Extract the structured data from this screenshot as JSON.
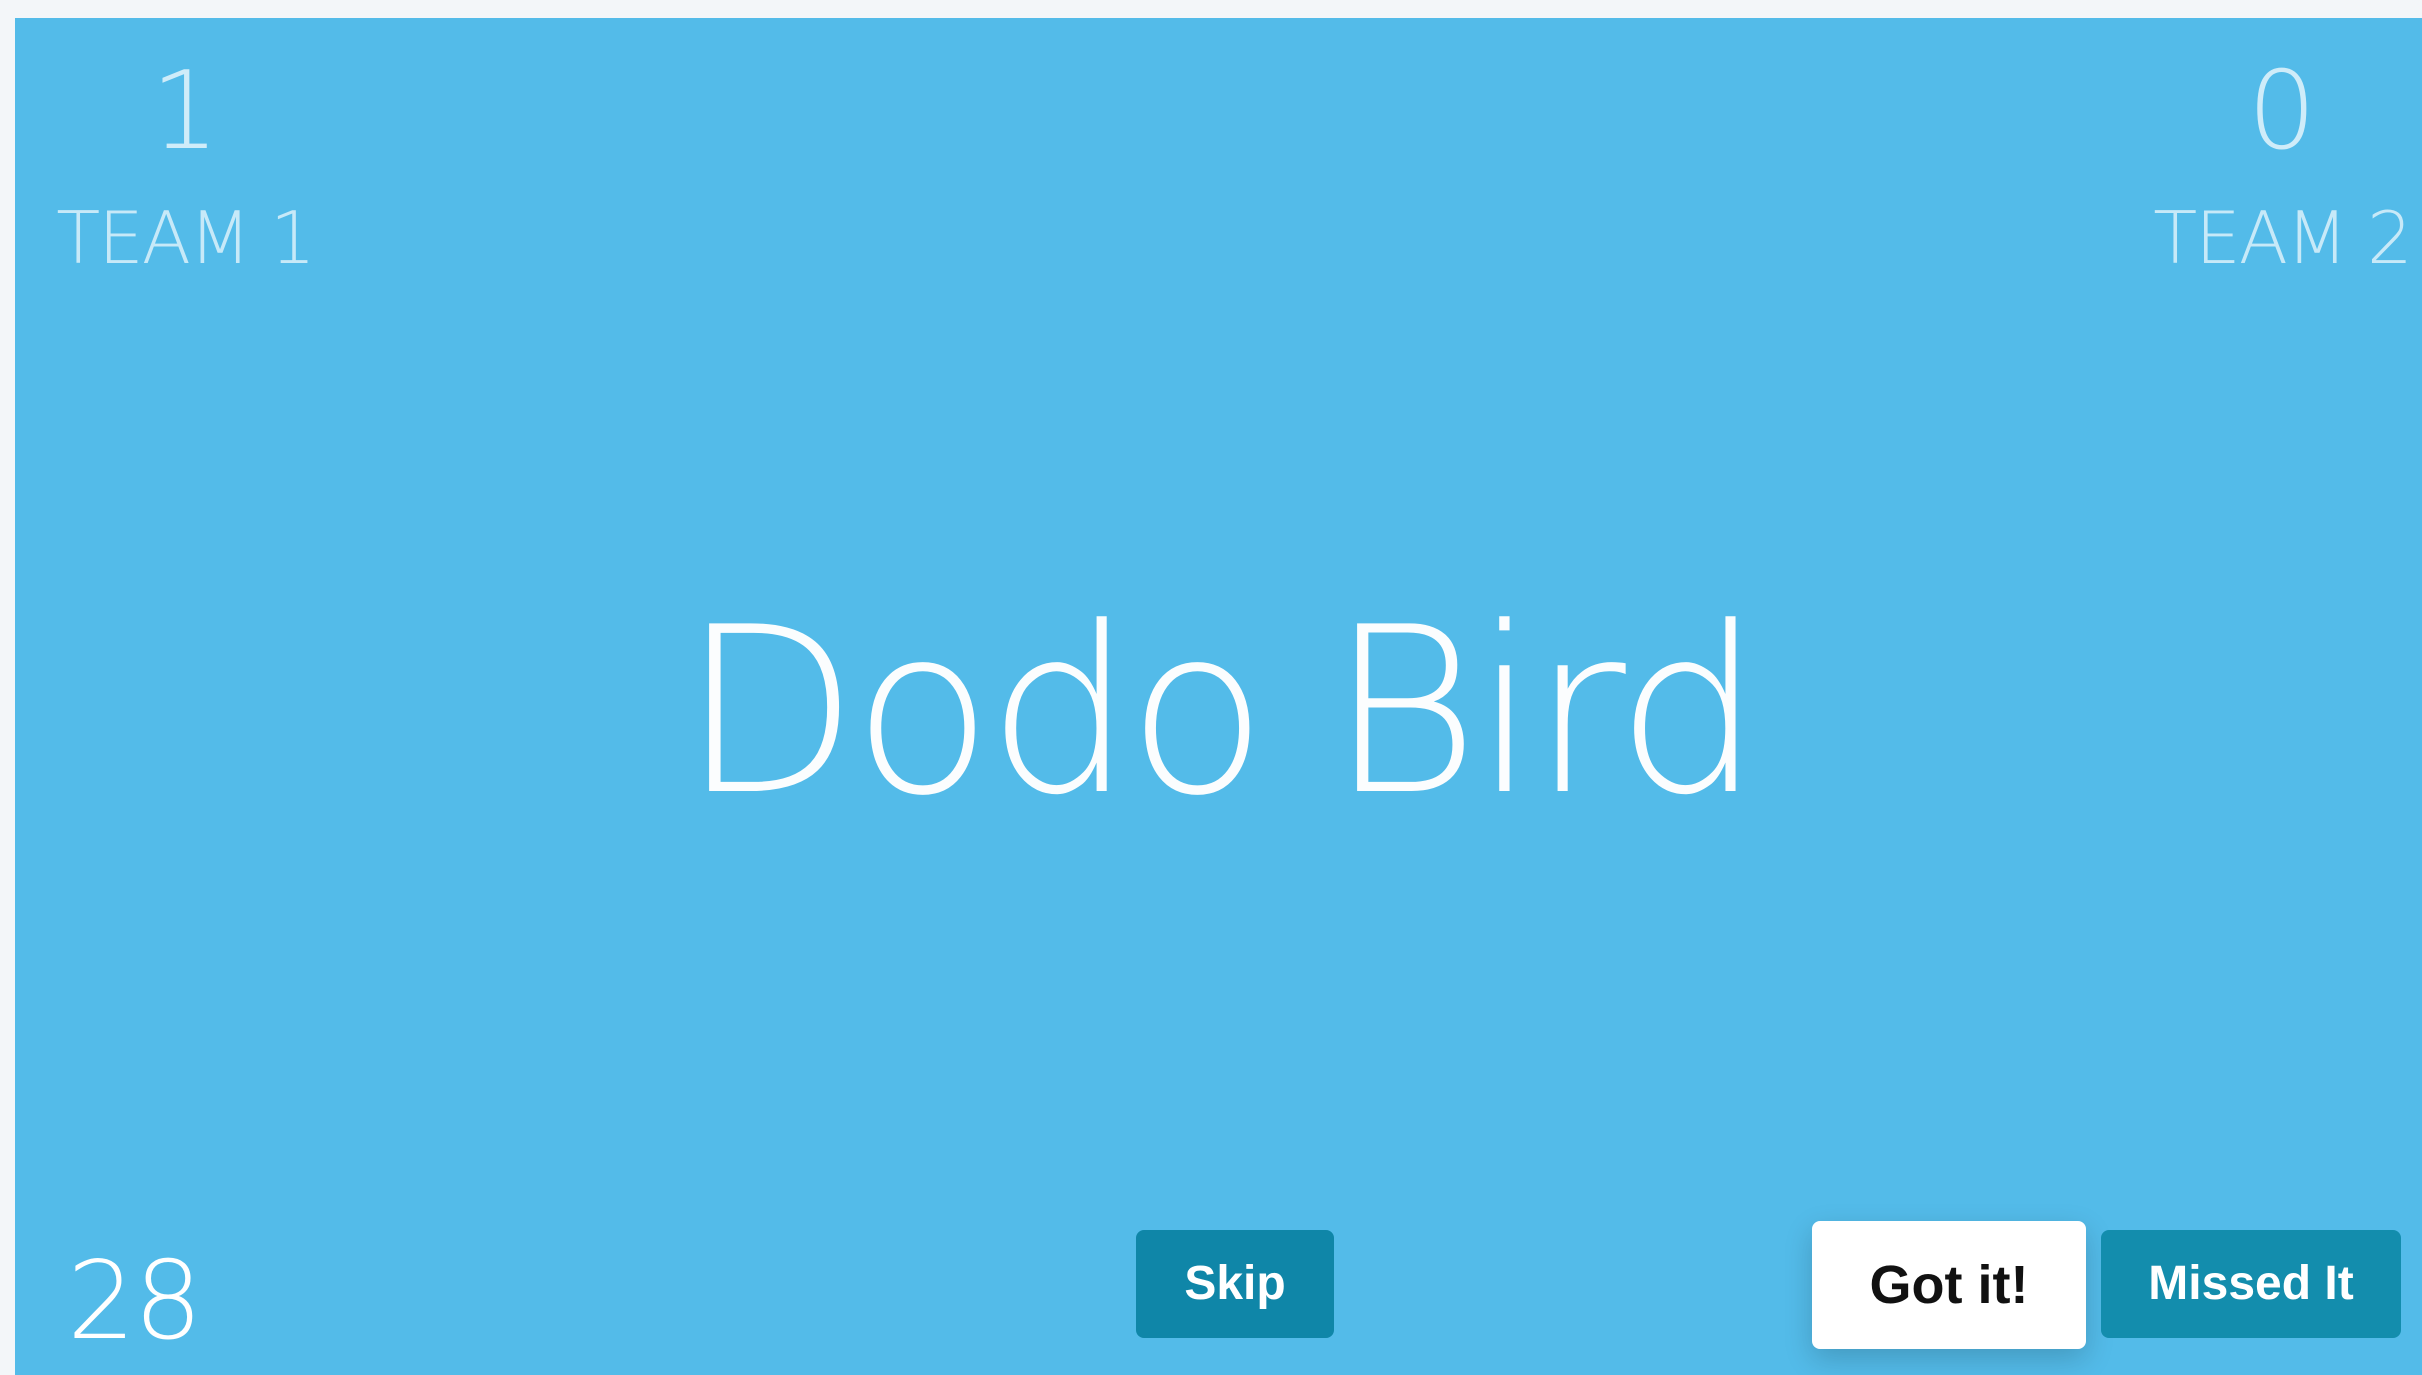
{
  "scores": {
    "team1": {
      "value": "1",
      "label": "TEAM 1"
    },
    "team2": {
      "value": "0",
      "label": "TEAM 2"
    }
  },
  "card": {
    "word": "Dodo Bird"
  },
  "timer": {
    "value": "28"
  },
  "buttons": {
    "skip": "Skip",
    "got_it": "Got it!",
    "missed_it": "Missed It"
  },
  "colors": {
    "background": "#53bbe9",
    "skip_button": "#0f86a8",
    "missed_button": "#138dad",
    "got_button": "#ffffff"
  }
}
